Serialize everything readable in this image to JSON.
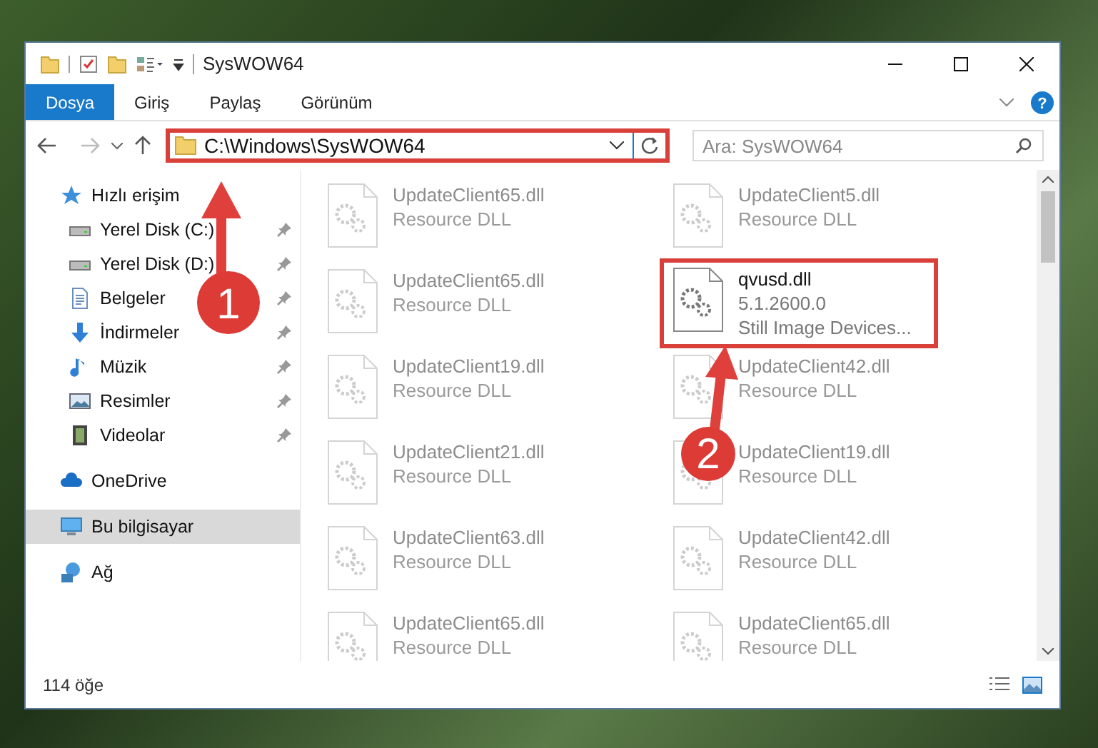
{
  "window": {
    "title": "SysWOW64"
  },
  "ribbon_tabs": [
    {
      "label": "Dosya",
      "selected": true
    },
    {
      "label": "Giriş",
      "selected": false
    },
    {
      "label": "Paylaş",
      "selected": false
    },
    {
      "label": "Görünüm",
      "selected": false
    }
  ],
  "address_bar": {
    "path": "C:\\Windows\\SysWOW64"
  },
  "search": {
    "placeholder": "Ara: SysWOW64"
  },
  "sidebar": {
    "items": [
      {
        "label": "Hızlı erişim",
        "kind": "star",
        "pinned": false,
        "selected": false
      },
      {
        "label": "Yerel Disk (C:)",
        "kind": "drive",
        "pinned": true,
        "selected": false
      },
      {
        "label": "Yerel Disk (D:)",
        "kind": "drive",
        "pinned": true,
        "selected": false
      },
      {
        "label": "Belgeler",
        "kind": "document",
        "pinned": true,
        "selected": false
      },
      {
        "label": "İndirmeler",
        "kind": "download",
        "pinned": true,
        "selected": false
      },
      {
        "label": "Müzik",
        "kind": "music",
        "pinned": true,
        "selected": false
      },
      {
        "label": "Resimler",
        "kind": "picture",
        "pinned": true,
        "selected": false
      },
      {
        "label": "Videolar",
        "kind": "video",
        "pinned": true,
        "selected": false
      },
      {
        "label": "OneDrive",
        "kind": "cloud",
        "pinned": false,
        "selected": false
      },
      {
        "label": "Bu bilgisayar",
        "kind": "computer",
        "pinned": false,
        "selected": true
      },
      {
        "label": "Ağ",
        "kind": "network",
        "pinned": false,
        "selected": false
      }
    ]
  },
  "files": [
    {
      "name": "UpdateClient65.dll",
      "details": [
        "Resource DLL"
      ],
      "faded": true
    },
    {
      "name": "UpdateClient5.dll",
      "details": [
        "Resource DLL"
      ],
      "faded": true
    },
    {
      "name": "UpdateClient65.dll",
      "details": [
        "Resource DLL"
      ],
      "faded": true
    },
    {
      "name": "qvusd.dll",
      "details": [
        "5.1.2600.0",
        "Still Image Devices..."
      ],
      "faded": false
    },
    {
      "name": "UpdateClient19.dll",
      "details": [
        "Resource DLL"
      ],
      "faded": true
    },
    {
      "name": "UpdateClient42.dll",
      "details": [
        "Resource DLL"
      ],
      "faded": true
    },
    {
      "name": "UpdateClient21.dll",
      "details": [
        "Resource DLL"
      ],
      "faded": true
    },
    {
      "name": "UpdateClient19.dll",
      "details": [
        "Resource DLL"
      ],
      "faded": true
    },
    {
      "name": "UpdateClient63.dll",
      "details": [
        "Resource DLL"
      ],
      "faded": true
    },
    {
      "name": "UpdateClient42.dll",
      "details": [
        "Resource DLL"
      ],
      "faded": true
    },
    {
      "name": "UpdateClient65.dll",
      "details": [
        "Resource DLL"
      ],
      "faded": true
    },
    {
      "name": "UpdateClient65.dll",
      "details": [
        "Resource DLL"
      ],
      "faded": true
    }
  ],
  "help_button": {
    "label": "?"
  },
  "status_bar": {
    "item_count": "114 öğe"
  },
  "annotations": [
    {
      "label": "1"
    },
    {
      "label": "2"
    }
  ]
}
